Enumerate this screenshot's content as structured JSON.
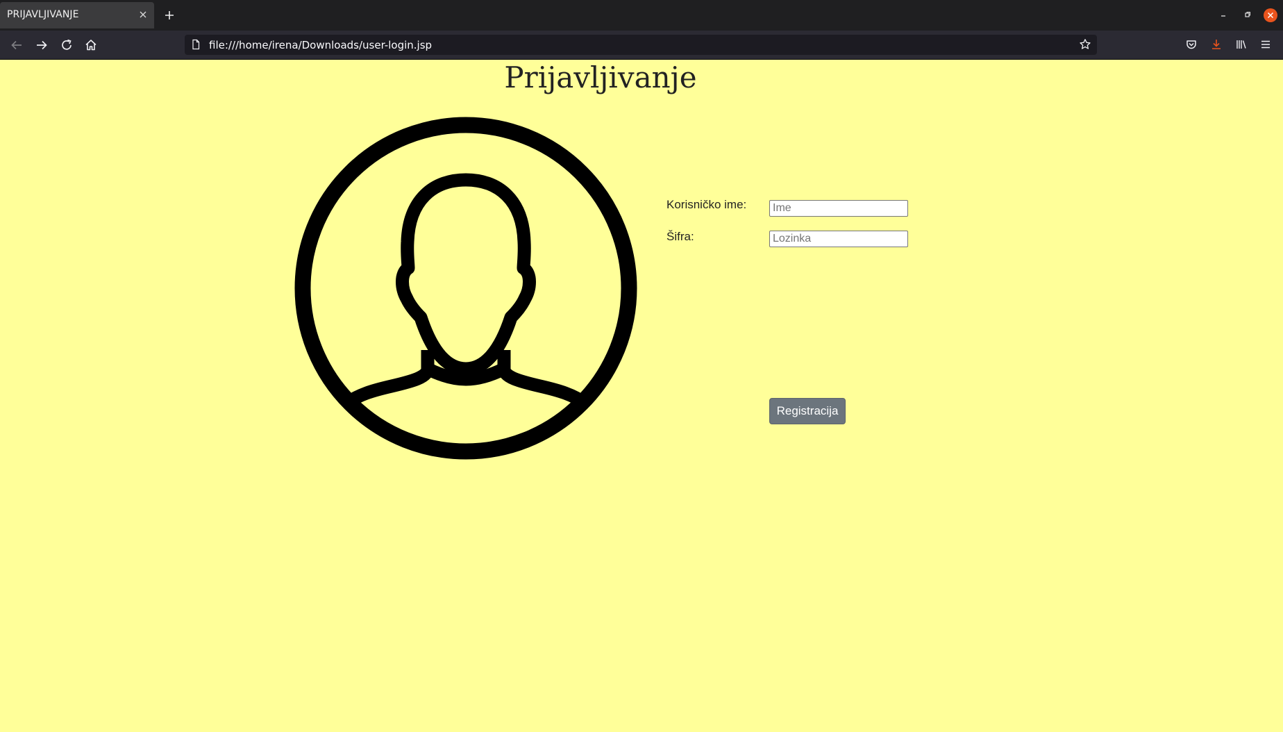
{
  "browser": {
    "tab": {
      "title": "PRIJAVLJIVANJE",
      "close_icon": "close-icon"
    },
    "url": "file:///home/irena/Downloads/user-login.jsp",
    "icons": {
      "back": "arrow-left-icon",
      "forward": "arrow-right-icon",
      "reload": "reload-icon",
      "home": "home-icon",
      "bookmark": "star-icon",
      "pocket": "pocket-icon",
      "download": "download-icon",
      "library": "library-icon",
      "menu": "hamburger-menu-icon"
    },
    "colors": {
      "tabstrip": "#1f1f21",
      "navbar": "#2b2a33",
      "window_close": "#e9541d",
      "download_accent": "#e9541d"
    }
  },
  "page": {
    "title": "Prijavljivanje",
    "background": "#ffff99",
    "avatar_icon": "user-avatar-icon",
    "form": {
      "username_label": "Korisničko ime:",
      "username_placeholder": "Ime",
      "password_label": "Šifra:",
      "password_placeholder": "Lozinka",
      "submit_label": "Registracija",
      "submit_color": "#6c757d"
    }
  }
}
